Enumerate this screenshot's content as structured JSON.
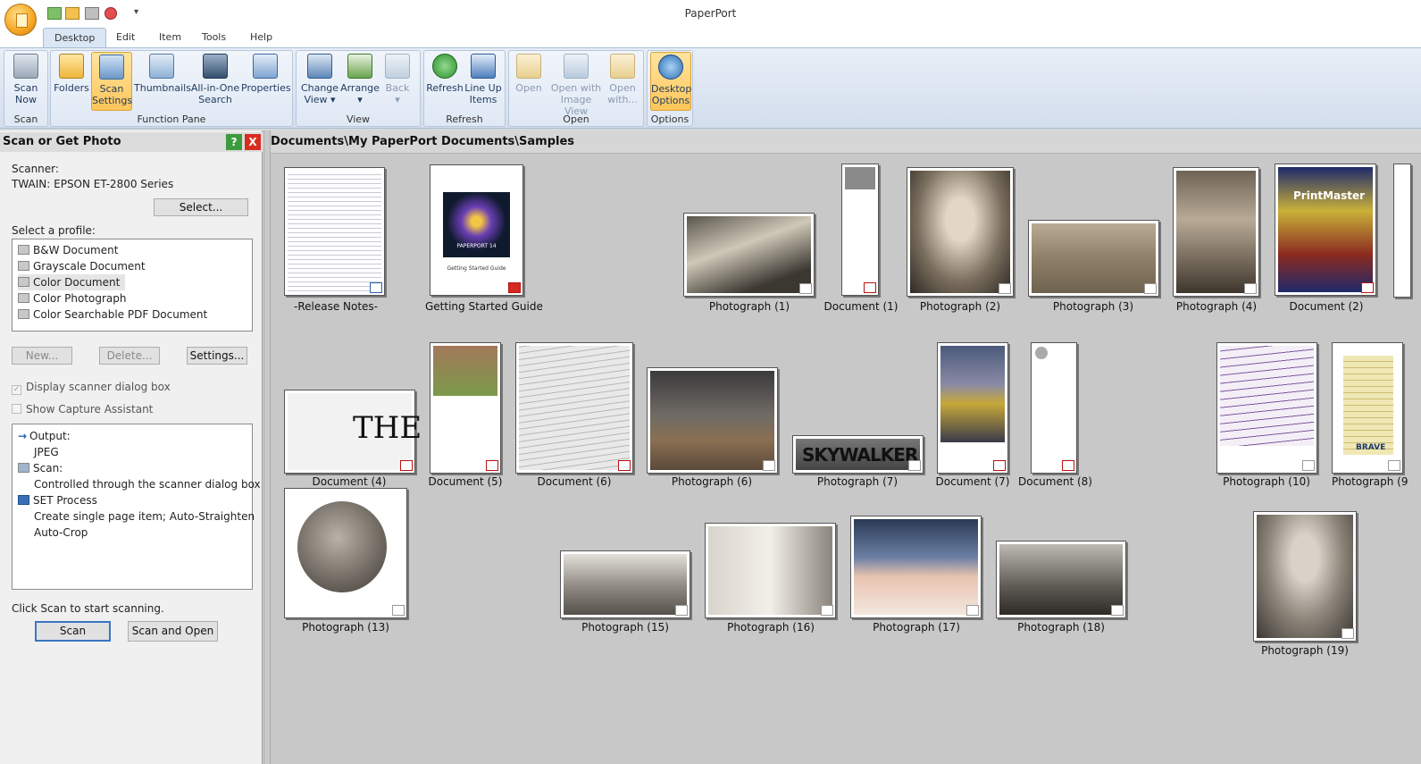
{
  "window": {
    "title": "PaperPort"
  },
  "quick_access": [
    "scan-icon",
    "folder-icon",
    "print-icon",
    "stop-icon"
  ],
  "tabs": [
    "Desktop",
    "Edit",
    "Item",
    "Tools",
    "Help"
  ],
  "ribbon": {
    "groups": [
      "Scan",
      "Function Pane",
      "View",
      "Refresh",
      "Open",
      "Options"
    ],
    "buttons": [
      {
        "label": "Scan\nNow",
        "icon": "scanner-icon"
      },
      {
        "label": "Folders",
        "icon": "folders-icon"
      },
      {
        "label": "Scan\nSettings",
        "icon": "scan-settings-icon"
      },
      {
        "label": "Thumbnails",
        "icon": "thumbnails-icon"
      },
      {
        "label": "All-in-One\nSearch",
        "icon": "binoculars-icon"
      },
      {
        "label": "Properties",
        "icon": "properties-icon"
      },
      {
        "label": "Change\nView ▾",
        "icon": "change-view-icon"
      },
      {
        "label": "Arrange\n▾",
        "icon": "arrange-icon"
      },
      {
        "label": "Back\n▾",
        "icon": "back-icon"
      },
      {
        "label": "Refresh",
        "icon": "refresh-icon"
      },
      {
        "label": "Line Up\nItems",
        "icon": "line-up-icon"
      },
      {
        "label": "Open",
        "icon": "open-icon"
      },
      {
        "label": "Open with\nImage View",
        "icon": "image-view-icon"
      },
      {
        "label": "Open\nwith...",
        "icon": "open-with-icon"
      },
      {
        "label": "Desktop\nOptions",
        "icon": "desktop-options-icon"
      }
    ]
  },
  "pane": {
    "title": "Scan or Get Photo",
    "help": "?",
    "close": "X",
    "scanner_label": "Scanner:",
    "scanner_name": "TWAIN: EPSON ET-2800 Series",
    "select_button": "Select...",
    "profile_label": "Select a profile:",
    "profiles": [
      "B&W Document",
      "Grayscale Document",
      "Color Document",
      "Color Photograph",
      "Color Searchable PDF Document"
    ],
    "new_button": "New...",
    "delete_button": "Delete...",
    "settings_button": "Settings...",
    "display_dialog": "Display scanner dialog box",
    "capture_assistant": "Show Capture Assistant",
    "details": [
      "Output:",
      "JPEG",
      "Scan:",
      "Controlled through the scanner dialog box",
      "SET Process",
      "Create single page item; Auto-Straighten",
      "Auto-Crop"
    ],
    "hint": "Click Scan to start scanning.",
    "scan_button": "Scan",
    "scan_open_button": "Scan and Open"
  },
  "content": {
    "path": "Documents\\My PaperPort Documents\\Samples",
    "items": [
      "-Release Notes-",
      "Getting Started Guide",
      "Photograph (1)",
      "Document (1)",
      "Photograph (2)",
      "Photograph (3)",
      "Photograph (4)",
      "Document (2)",
      "Document (4)",
      "Document (5)",
      "Document (6)",
      "Photograph (6)",
      "Photograph (7)",
      "Document (7)",
      "Document (8)",
      "Photograph (10)",
      "Photograph (9",
      "Photograph (13)",
      "Photograph (15)",
      "Photograph (16)",
      "Photograph (17)",
      "Photograph (18)",
      "Photograph (19)"
    ],
    "thumb_text": {
      "guide": "PAPERPORT 14",
      "guide_sub": "Getting Started Guide",
      "skywalker": "SKYWALKER",
      "the": "THE",
      "printmaster": "PrintMaster",
      "brave": "BRAVE"
    }
  }
}
